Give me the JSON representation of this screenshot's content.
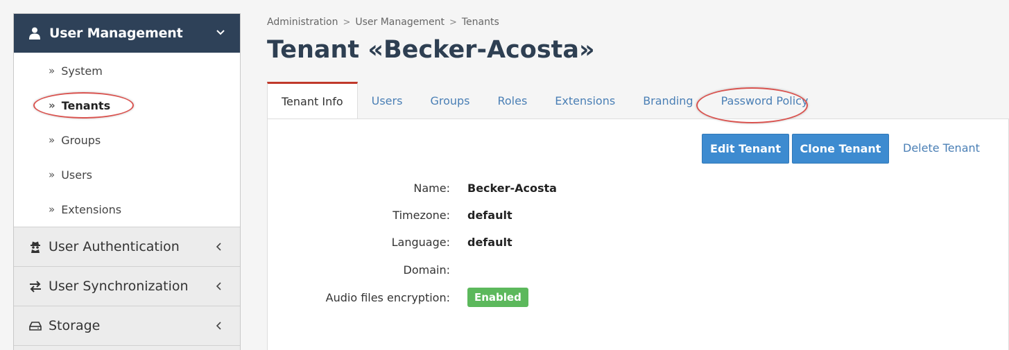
{
  "sidebar": {
    "header": {
      "title": "User Management",
      "icon": "user-icon"
    },
    "items": [
      {
        "label": "System",
        "active": false
      },
      {
        "label": "Tenants",
        "active": true
      },
      {
        "label": "Groups",
        "active": false
      },
      {
        "label": "Users",
        "active": false
      },
      {
        "label": "Extensions",
        "active": false
      }
    ],
    "sections": [
      {
        "label": "User Authentication",
        "icon": "spy-icon"
      },
      {
        "label": "User Synchronization",
        "icon": "exchange-icon"
      },
      {
        "label": "Storage",
        "icon": "hdd-icon"
      }
    ]
  },
  "breadcrumb": [
    "Administration",
    "User Management",
    "Tenants"
  ],
  "page_title": "Tenant «Becker-Acosta»",
  "tabs": [
    {
      "label": "Tenant Info",
      "active": true
    },
    {
      "label": "Users"
    },
    {
      "label": "Groups"
    },
    {
      "label": "Roles"
    },
    {
      "label": "Extensions"
    },
    {
      "label": "Branding"
    },
    {
      "label": "Password Policy"
    }
  ],
  "actions": {
    "edit": "Edit Tenant",
    "clone": "Clone Tenant",
    "delete": "Delete Tenant"
  },
  "details": {
    "name_label": "Name:",
    "name_value": "Becker-Acosta",
    "timezone_label": "Timezone:",
    "timezone_value": "default",
    "language_label": "Language:",
    "language_value": "default",
    "domain_label": "Domain:",
    "domain_value": "",
    "audio_label": "Audio files encryption:",
    "audio_value": "Enabled"
  },
  "colors": {
    "sidebar_header": "#2e4158",
    "accent_blue": "#3d8bd0",
    "link_blue": "#4a7fb5",
    "active_tab_border": "#c0392b",
    "badge_green": "#5cb85c",
    "annotation_red": "#d9534f"
  }
}
